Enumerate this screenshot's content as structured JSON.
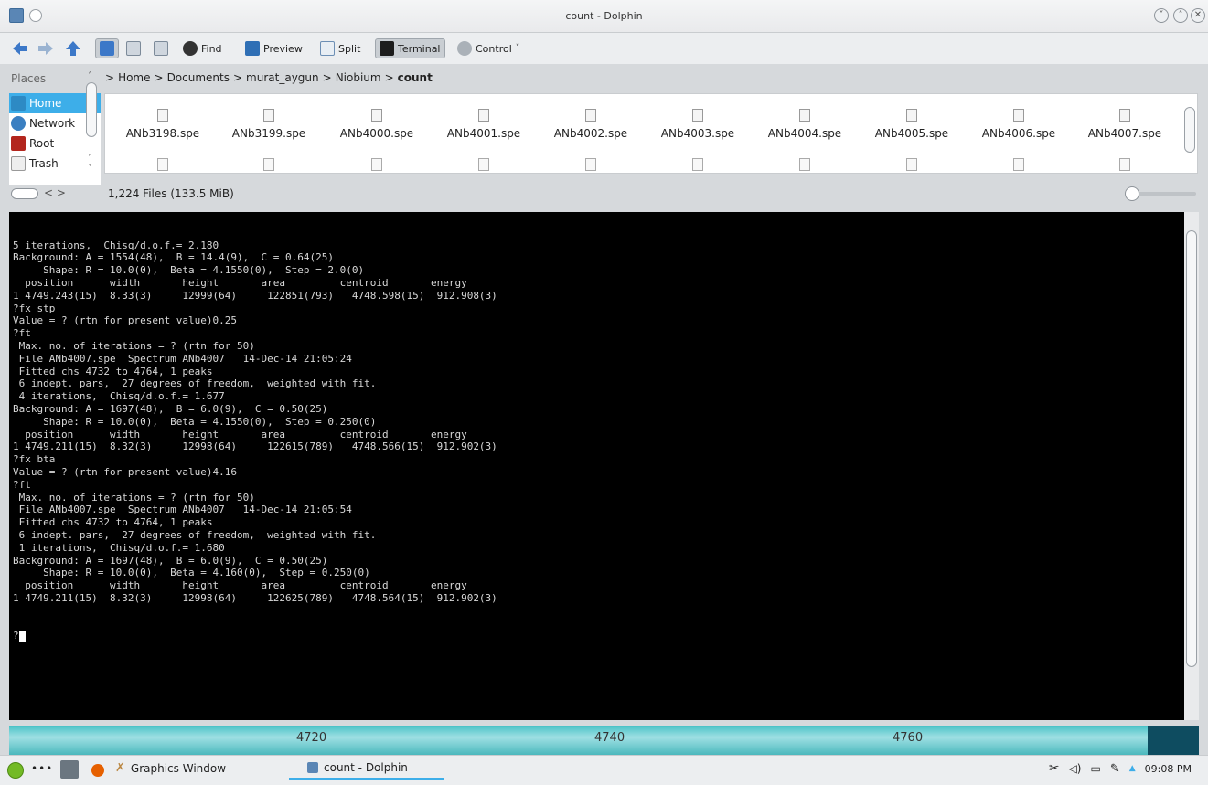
{
  "window": {
    "title": "count - Dolphin"
  },
  "toolbar": {
    "find_label": "Find",
    "preview_label": "Preview",
    "split_label": "Split",
    "terminal_label": "Terminal",
    "control_label": "Control"
  },
  "places": {
    "title": "Places",
    "items": [
      {
        "label": "Home",
        "icon": "home-folder-icon",
        "selected": true
      },
      {
        "label": "Network",
        "icon": "network-icon"
      },
      {
        "label": "Root",
        "icon": "root-folder-icon"
      },
      {
        "label": "Trash",
        "icon": "trash-icon"
      }
    ]
  },
  "breadcrumb": [
    "Home",
    "Documents",
    "murat_aygun",
    "Niobium"
  ],
  "breadcrumb_current": "count",
  "files": [
    "ANb3198.spe",
    "ANb3199.spe",
    "ANb4000.spe",
    "ANb4001.spe",
    "ANb4002.spe",
    "ANb4003.spe",
    "ANb4004.spe",
    "ANb4005.spe",
    "ANb4006.spe",
    "ANb4007.spe"
  ],
  "status": {
    "text": "1,224 Files (133.5 MiB)"
  },
  "terminal": {
    "lines": [
      "5 iterations,  Chisq/d.o.f.= 2.180",
      "Background: A = 1554(48),  B = 14.4(9),  C = 0.64(25)",
      "     Shape: R = 10.0(0),  Beta = 4.1550(0),  Step = 2.0(0)",
      "  position      width       height       area         centroid       energy",
      "1 4749.243(15)  8.33(3)     12999(64)     122851(793)   4748.598(15)  912.908(3)",
      "?fx stp",
      "Value = ? (rtn for present value)0.25",
      "?ft",
      " Max. no. of iterations = ? (rtn for 50)",
      " File ANb4007.spe  Spectrum ANb4007   14-Dec-14 21:05:24",
      " Fitted chs 4732 to 4764, 1 peaks",
      " 6 indept. pars,  27 degrees of freedom,  weighted with fit.",
      " 4 iterations,  Chisq/d.o.f.= 1.677",
      "Background: A = 1697(48),  B = 6.0(9),  C = 0.50(25)",
      "     Shape: R = 10.0(0),  Beta = 4.1550(0),  Step = 0.250(0)",
      "  position      width       height       area         centroid       energy",
      "1 4749.211(15)  8.32(3)     12998(64)     122615(789)   4748.566(15)  912.902(3)",
      "?fx bta",
      "Value = ? (rtn for present value)4.16",
      "?ft",
      " Max. no. of iterations = ? (rtn for 50)",
      " File ANb4007.spe  Spectrum ANb4007   14-Dec-14 21:05:54",
      " Fitted chs 4732 to 4764, 1 peaks",
      " 6 indept. pars,  27 degrees of freedom,  weighted with fit.",
      " 1 iterations,  Chisq/d.o.f.= 1.680",
      "Background: A = 1697(48),  B = 6.0(9),  C = 0.50(25)",
      "     Shape: R = 10.0(0),  Beta = 4.160(0),  Step = 0.250(0)",
      "  position      width       height       area         centroid       energy",
      "1 4749.211(15)  8.32(3)     12998(64)     122625(789)   4748.564(15)  912.902(3)"
    ],
    "prompt": "?"
  },
  "graph_axis": {
    "labels": [
      "4720",
      "4740",
      "4760"
    ]
  },
  "taskbar": {
    "tasks": [
      {
        "label": "Graphics Window",
        "icon": "graphics-window-icon"
      },
      {
        "label": "count - Dolphin",
        "icon": "dolphin-icon",
        "active": true
      }
    ],
    "clock": "09:08 PM"
  },
  "colors": {
    "accent": "#3daee9",
    "terminal_bg": "#000000",
    "axis_band": "#49c2c7"
  }
}
